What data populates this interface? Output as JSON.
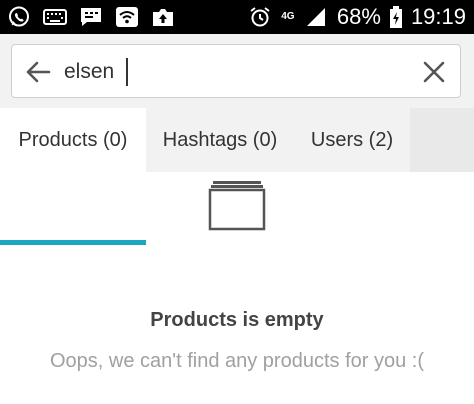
{
  "status_bar": {
    "icons": [
      "whatsapp-icon",
      "keyboard-icon",
      "message-icon",
      "wifi-icon",
      "photo-upload-icon",
      "alarm-icon",
      "signal-icon",
      "battery-charging-icon"
    ],
    "network": "4G",
    "battery": "68%",
    "time": "19:19"
  },
  "search": {
    "value": "elsen",
    "back_icon": "arrow-left-icon",
    "clear_icon": "close-icon"
  },
  "tabs": [
    {
      "label": "Products (0)",
      "active": true
    },
    {
      "label": "Hashtags (0)",
      "active": false
    },
    {
      "label": "Users (2)",
      "active": false
    }
  ],
  "empty_state": {
    "icon": "empty-box-icon",
    "title": "Products is empty",
    "message": "Oops, we can't find any products for you :("
  },
  "colors": {
    "accent": "#1ba7bd",
    "status_bar": "#000000",
    "text": "#333333",
    "muted": "#a0a0a0"
  }
}
